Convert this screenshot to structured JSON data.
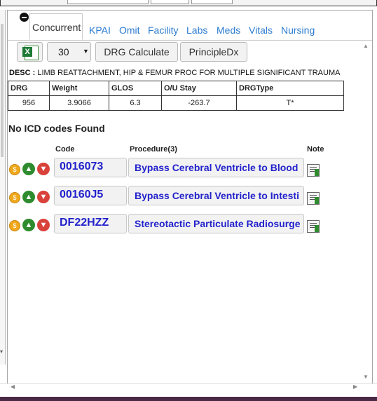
{
  "tabs": [
    "Concurrent",
    "KPAI",
    "Omit",
    "Facility",
    "Labs",
    "Meds",
    "Vitals",
    "Nursing"
  ],
  "toolbar": {
    "count_value": "30",
    "drg_calculate_label": "DRG Calculate",
    "principle_dx_label": "PrincipleDx"
  },
  "desc": {
    "label": "DESC :",
    "text": "LIMB REATTACHMENT, HIP & FEMUR PROC FOR MULTIPLE SIGNIFICANT TRAUMA"
  },
  "drg_table": {
    "headers": [
      "DRG",
      "Weight",
      "GLOS",
      "O/U Stay",
      "DRGType"
    ],
    "row": [
      "956",
      "3.9066",
      "6.3",
      "-263.7",
      "T*"
    ]
  },
  "no_icd_text": "No ICD codes Found",
  "procedure_table": {
    "headers": {
      "code": "Code",
      "procedure": "Procedure(3)",
      "note": "Note"
    },
    "rows": [
      {
        "code": "0016073",
        "procedure": "Bypass Cerebral Ventricle to Blood"
      },
      {
        "code": "00160J5",
        "procedure": "Bypass Cerebral Ventricle to Intesti"
      },
      {
        "code": "DF22HZZ",
        "procedure": "Stereotactic Particulate Radiosurge"
      }
    ]
  }
}
